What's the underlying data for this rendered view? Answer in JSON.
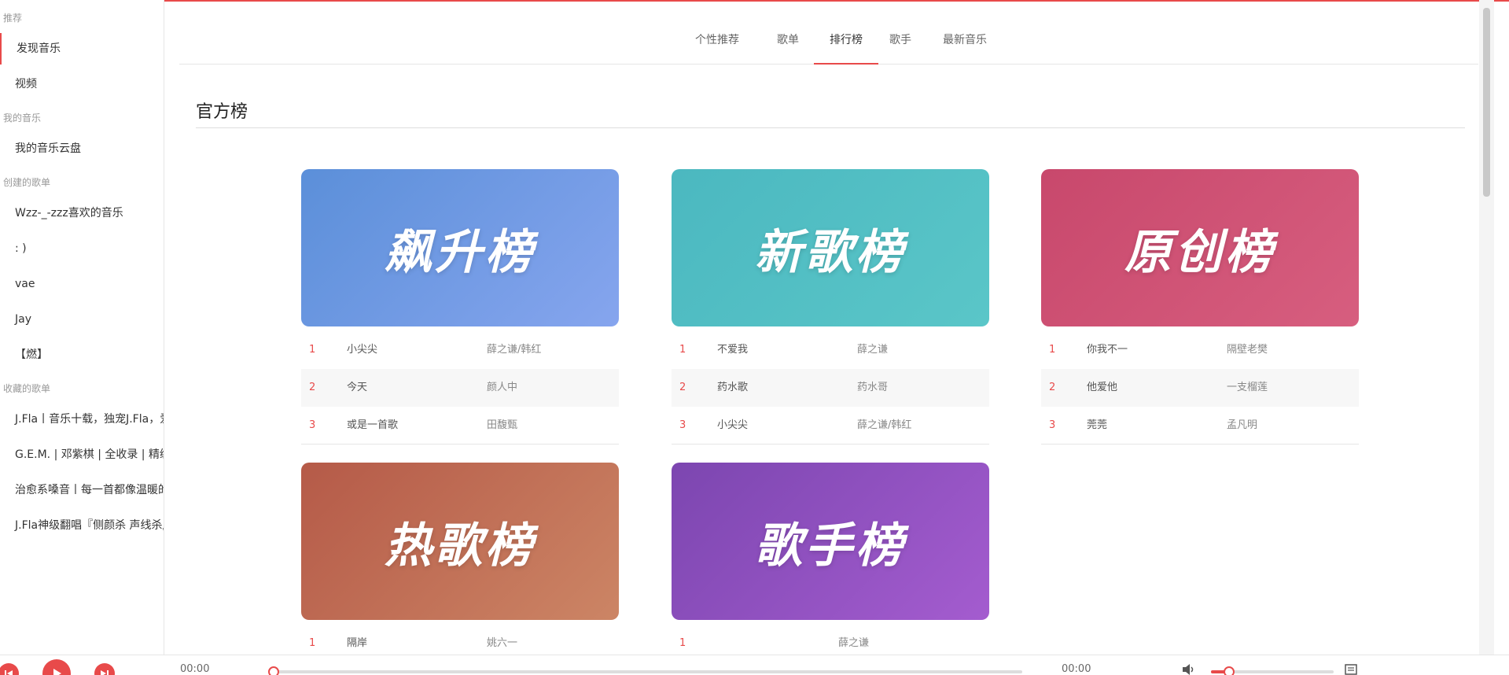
{
  "sidebar": {
    "sections": {
      "recommend": "推荐",
      "my_music": "我的音乐",
      "created": "创建的歌单",
      "collected": "收藏的歌单"
    },
    "items": {
      "discover": "发现音乐",
      "video": "视频",
      "cloud": "我的音乐云盘",
      "liked": "Wzz-_-zzz喜欢的音乐",
      "smile": ": )",
      "vae": "vae",
      "jay": "Jay",
      "burn": "【燃】",
      "jfla": "J.Fla丨音乐十载，独宠J.Fla，爱",
      "gem": "G.E.M. | 邓紫棋 | 全收录 | 精编",
      "heal": "治愈系嗓音丨每一首都像温暖的",
      "jfla2": "J.Fla神级翻唱『侧颜杀 声线杀』"
    }
  },
  "tabs": [
    "个性推荐",
    "歌单",
    "排行榜",
    "歌手",
    "最新音乐"
  ],
  "section_title": "官方榜",
  "boards": [
    {
      "title": "飙升榜",
      "colors": [
        "#5b8fd9",
        "#86a5ee"
      ],
      "rows": [
        {
          "rank": "1",
          "song": "小尖尖",
          "artist": "薛之谦/韩红"
        },
        {
          "rank": "2",
          "song": "今天",
          "artist": "颜人中"
        },
        {
          "rank": "3",
          "song": "或是一首歌",
          "artist": "田馥甄"
        }
      ]
    },
    {
      "title": "新歌榜",
      "colors": [
        "#4bb8c0",
        "#5ac6c8"
      ],
      "rows": [
        {
          "rank": "1",
          "song": "不爱我",
          "artist": "薛之谦"
        },
        {
          "rank": "2",
          "song": "药水歌",
          "artist": "药水哥"
        },
        {
          "rank": "3",
          "song": "小尖尖",
          "artist": "薛之谦/韩红"
        }
      ]
    },
    {
      "title": "原创榜",
      "colors": [
        "#c8486c",
        "#d75e7f"
      ],
      "rows": [
        {
          "rank": "1",
          "song": "你我不一",
          "artist": "隔壁老樊"
        },
        {
          "rank": "2",
          "song": "他爱他",
          "artist": "一支榴莲"
        },
        {
          "rank": "3",
          "song": "莞莞",
          "artist": "孟凡明"
        }
      ]
    },
    {
      "title": "热歌榜",
      "colors": [
        "#b55a48",
        "#cc8565"
      ],
      "rows": [
        {
          "rank": "1",
          "song": "隔岸",
          "artist": "姚六一"
        }
      ]
    },
    {
      "title": "歌手榜",
      "colors": [
        "#7c46b0",
        "#a45ccf"
      ],
      "rows": [
        {
          "rank": "1",
          "song": "",
          "artist": "薛之谦"
        }
      ]
    }
  ],
  "player": {
    "time_current": "00:00",
    "time_total": "00:00",
    "progress": 0,
    "volume": 0.15
  }
}
